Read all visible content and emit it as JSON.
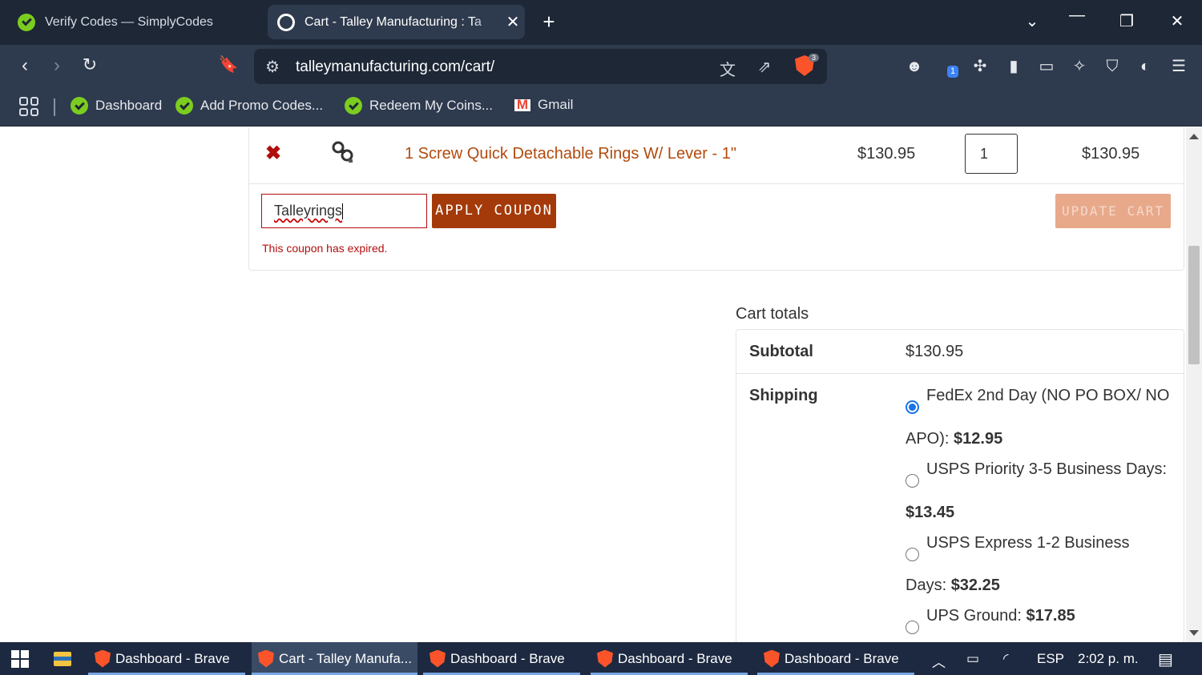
{
  "browser": {
    "tabs": [
      {
        "title": "Verify Codes — SimplyCodes",
        "active": false
      },
      {
        "title": "Cart - Talley Manufacturing : Ta",
        "active": true
      }
    ],
    "url": "talleymanufacturing.com/cart/",
    "shield_count": "3",
    "ext_badge": "1",
    "bookmarks": [
      {
        "label": "Dashboard"
      },
      {
        "label": "Add Promo Codes..."
      },
      {
        "label": "Redeem My Coins..."
      },
      {
        "label": "Gmail"
      }
    ]
  },
  "cart": {
    "item": {
      "remove_icon": "✖",
      "name": "1 Screw Quick Detachable Rings W/ Lever - 1\"",
      "price": "$130.95",
      "quantity": "1",
      "subtotal": "$130.95"
    },
    "coupon": {
      "value": "Talleyrings",
      "apply_label": "APPLY COUPON",
      "update_label": "UPDATE CART",
      "error": "This coupon has expired."
    }
  },
  "totals": {
    "title": "Cart totals",
    "subtotal_label": "Subtotal",
    "subtotal_value": "$130.95",
    "shipping_label": "Shipping",
    "options": [
      {
        "line1": "FedEx 2nd Day (NO PO BOX/ NO",
        "line2_text": "APO): ",
        "price": "$12.95",
        "checked": true
      },
      {
        "line1": "USPS Priority 3-5 Business Days:",
        "line2_text": "",
        "price": "$13.45",
        "checked": false
      },
      {
        "line1": "USPS Express 1-2 Business",
        "line2_text": "Days: ",
        "price": "$32.25",
        "checked": false
      },
      {
        "line1_text": "UPS Ground: ",
        "price": "$17.85",
        "checked": false
      }
    ]
  },
  "taskbar": {
    "items": [
      {
        "label": "Dashboard - Brave"
      },
      {
        "label": "Cart - Talley Manufa..."
      },
      {
        "label": "Dashboard - Brave"
      },
      {
        "label": "Dashboard - Brave"
      },
      {
        "label": "Dashboard - Brave"
      }
    ],
    "language": "ESP",
    "time": "2:02 p. m."
  },
  "colors": {
    "accent": "#a43a0a",
    "error": "#b10e0e",
    "link": "#b24a0e",
    "radio": "#1a73e8"
  }
}
